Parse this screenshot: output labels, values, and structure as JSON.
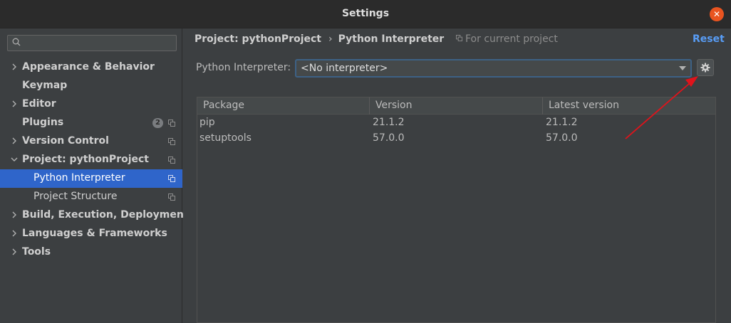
{
  "window": {
    "title": "Settings"
  },
  "colors": {
    "accent": "#2f65ca",
    "link": "#589df6",
    "close": "#e95420",
    "annotation_arrow": "#e0131b"
  },
  "search": {
    "placeholder": ""
  },
  "sidebar": {
    "items": [
      {
        "label": "Appearance & Behavior",
        "expandable": true
      },
      {
        "label": "Keymap",
        "expandable": false
      },
      {
        "label": "Editor",
        "expandable": true
      },
      {
        "label": "Plugins",
        "expandable": false,
        "badge": "2"
      },
      {
        "label": "Version Control",
        "expandable": true
      },
      {
        "label": "Project: pythonProject",
        "expandable": true,
        "expanded": true
      },
      {
        "label": "Python Interpreter",
        "child": true,
        "selected": true
      },
      {
        "label": "Project Structure",
        "child": true
      },
      {
        "label": "Build, Execution, Deployment",
        "expandable": true
      },
      {
        "label": "Languages & Frameworks",
        "expandable": true
      },
      {
        "label": "Tools",
        "expandable": true
      }
    ]
  },
  "header": {
    "breadcrumb": [
      "Project: pythonProject",
      "Python Interpreter"
    ],
    "breadcrumb_sep": "›",
    "scope": "For current project",
    "reset": "Reset"
  },
  "interpreter": {
    "label": "Python Interpreter:",
    "value": "<No interpreter>"
  },
  "packages": {
    "columns": [
      "Package",
      "Version",
      "Latest version"
    ],
    "rows": [
      [
        "pip",
        "21.1.2",
        "21.1.2"
      ],
      [
        "setuptools",
        "57.0.0",
        "57.0.0"
      ]
    ]
  },
  "icons": {
    "close": "close-icon",
    "search": "search-icon",
    "gear": "gear-icon",
    "expand": "chevron-right-icon",
    "collapse": "chevron-down-icon",
    "project_scope": "project-scope-icon",
    "dropdown": "dropdown-arrow-icon"
  }
}
